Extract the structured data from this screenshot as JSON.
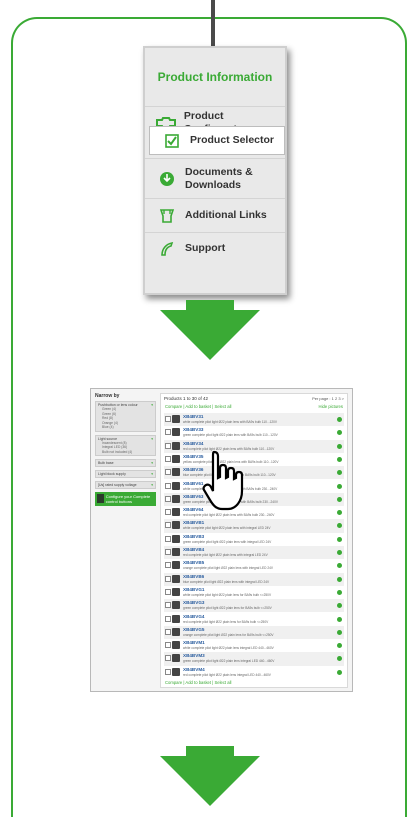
{
  "menu": {
    "title": "Product Information",
    "items": [
      {
        "label": "Product Configurator",
        "icon": "configurator-icon"
      },
      {
        "label": "Product Selector",
        "icon": "checkbox-icon",
        "selected": true
      },
      {
        "label": "Documents & Downloads",
        "icon": "download-icon"
      },
      {
        "label": "Additional Links",
        "icon": "links-icon"
      },
      {
        "label": "Support",
        "icon": "support-icon"
      }
    ]
  },
  "screenshot": {
    "sidebar": {
      "heading": "Narrow by",
      "filters": [
        {
          "label": "Pushbutton or lens colour",
          "options": [
            "Green (4)",
            "Green (6)",
            "Red (8)",
            "Orange (4)",
            "Blue (4)"
          ]
        },
        {
          "label": "Light source",
          "options": [
            "Incandescent (8)",
            "Integral LED (36)",
            "Bulb not included (4)"
          ]
        },
        {
          "label": "Bulb base",
          "options": []
        },
        {
          "label": "Light block supply",
          "options": []
        },
        {
          "label": "[Us] rated supply voltage",
          "options": []
        }
      ],
      "promo": "Configure your Complete control buttons"
    },
    "header": {
      "count": "Products 1 to 30 of 42",
      "per_page": "Per page : 1 2 3 >"
    },
    "actions": {
      "compare": "Compare",
      "add_to_basket": "Add to basket",
      "select_all": "Select all",
      "hide_pictures": "Hide pictures"
    },
    "rows": [
      {
        "code": "XB4BV31",
        "desc": "white complete pilot light Ø22 plain lens with BA9s bulb 110...120V"
      },
      {
        "code": "XB4BV33",
        "desc": "green complete pilot light Ø22 plain lens with BA9s bulb 110...120V"
      },
      {
        "code": "XB4BV34",
        "desc": "red complete pilot light Ø22 plain lens with BA9s bulb 110...120V"
      },
      {
        "code": "XB4BV35",
        "desc": "yellow complete pilot light Ø22 plain lens with BA9s bulb 110...120V"
      },
      {
        "code": "XB4BV36",
        "desc": "blue complete pilot light Ø22 plain lens with BA9s bulb 110...120V"
      },
      {
        "code": "XB4BV61",
        "desc": "white complete pilot light Ø22 plain lens with BA9s bulb 230...240V"
      },
      {
        "code": "XB4BV63",
        "desc": "green complete pilot light Ø22 plain lens with BA9s bulb 230...240V"
      },
      {
        "code": "XB4BV64",
        "desc": "red complete pilot light Ø22 plain lens with BA9s bulb 230...240V"
      },
      {
        "code": "XB4BVB1",
        "desc": "white complete pilot light Ø22 plain lens with integral LED 24V"
      },
      {
        "code": "XB4BVB3",
        "desc": "green complete pilot light Ø22 plain lens with integral LED 24V"
      },
      {
        "code": "XB4BVB4",
        "desc": "red complete pilot light Ø22 plain lens with integral LED 24V"
      },
      {
        "code": "XB4BVB5",
        "desc": "orange complete pilot light Ø22 plain lens with integral LED 24V"
      },
      {
        "code": "XB4BVB6",
        "desc": "blue complete pilot light Ø22 plain lens with integral LED 24V"
      },
      {
        "code": "XB4BVG1",
        "desc": "white complete pilot light Ø22 plain lens for BA9s bulb <=250V"
      },
      {
        "code": "XB4BVG3",
        "desc": "green complete pilot light Ø22 plain lens for BA9s bulb <=250V"
      },
      {
        "code": "XB4BVG4",
        "desc": "red complete pilot light Ø22 plain lens for BA9s bulb <=250V"
      },
      {
        "code": "XB4BVG5",
        "desc": "orange complete pilot light Ø22 plain lens for BA9s bulb <=250V"
      },
      {
        "code": "XB4BVM1",
        "desc": "white complete pilot light Ø22 plain lens integral LED 440...460V"
      },
      {
        "code": "XB4BVM3",
        "desc": "green complete pilot light Ø22 plain lens integral LED 440...460V"
      },
      {
        "code": "XB4BVM4",
        "desc": "red complete pilot light Ø22 plain lens integral LED 440...460V"
      }
    ]
  },
  "colors": {
    "accent": "#3aaa35",
    "link": "#2a5d9f"
  }
}
